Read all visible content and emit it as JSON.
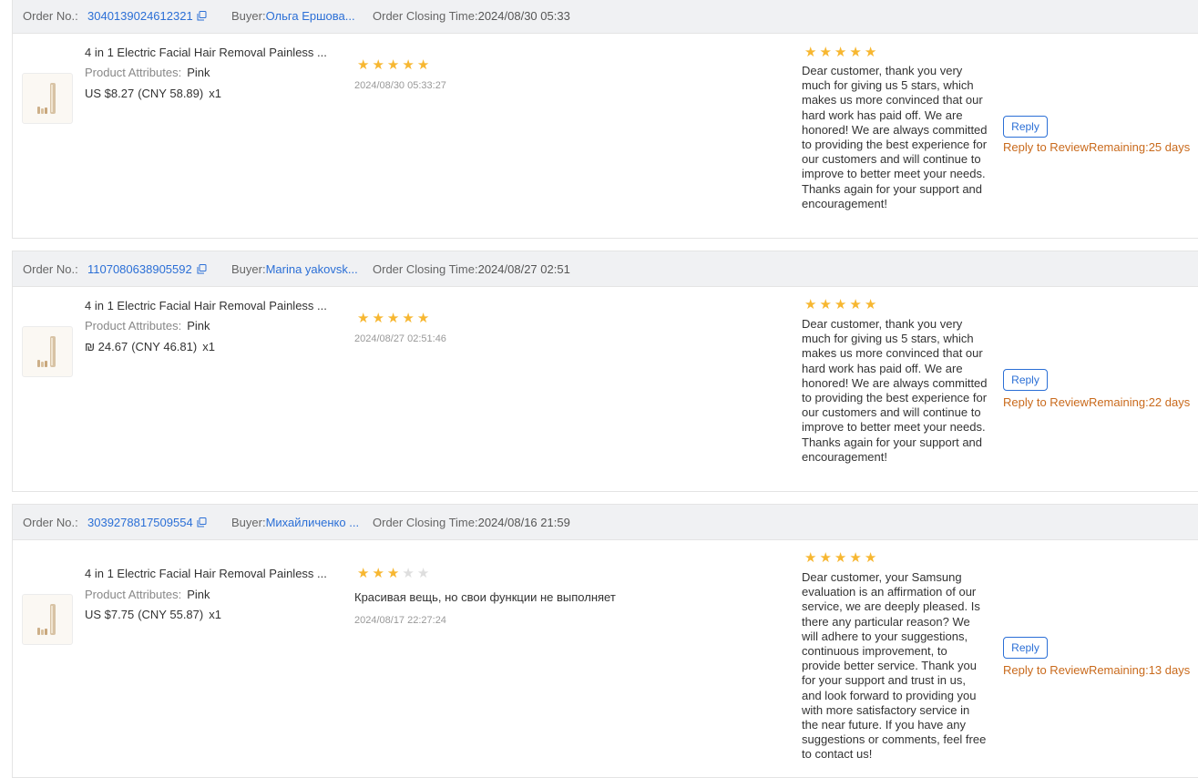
{
  "labels": {
    "order_no": "Order No.:",
    "buyer": "Buyer:",
    "closing": "Order Closing Time:",
    "product_attributes": "Product Attributes:",
    "reply_button": "Reply",
    "reply_to_review": "Reply to Review"
  },
  "colors": {
    "link": "#2b6fd6",
    "star_filled": "#f7b731",
    "star_empty": "#dedede",
    "remaining": "#c96a1c",
    "header_bg": "#f0f1f3"
  },
  "orders": [
    {
      "order_no": "3040139024612321",
      "buyer": "Ольга Ершова...",
      "closing_time": "2024/08/30 05:33",
      "product": {
        "title": "4 in 1 Electric Facial Hair Removal Painless ...",
        "attribute": "Pink",
        "price": "US $8.27",
        "cny": "(CNY  58.89)",
        "qty": "x1"
      },
      "rating": 5,
      "review_text": "",
      "review_date": "2024/08/30 05:33:27",
      "reply_rating": 5,
      "reply_text": "Dear customer, thank you very much for giving us 5 stars, which makes us more convinced that our hard work has paid off. We are honored! We are always committed to providing the best experience for our customers and will continue to improve to better meet your needs. Thanks again for your support and encouragement!",
      "remaining": "Remaining:25 days"
    },
    {
      "order_no": "1107080638905592",
      "buyer": "Marina yakovsk...",
      "closing_time": "2024/08/27 02:51",
      "product": {
        "title": "4 in 1 Electric Facial Hair Removal Painless ...",
        "attribute": "Pink",
        "price": "₪ 24.67",
        "cny": "(CNY  46.81)",
        "qty": "x1"
      },
      "rating": 5,
      "review_text": "",
      "review_date": "2024/08/27 02:51:46",
      "reply_rating": 5,
      "reply_text": "Dear customer, thank you very much for giving us 5 stars, which makes us more convinced that our hard work has paid off. We are honored! We are always committed to providing the best experience for our customers and will continue to improve to better meet your needs. Thanks again for your support and encouragement!",
      "remaining": "Remaining:22 days"
    },
    {
      "order_no": "3039278817509554",
      "buyer": "Михайличенко ...",
      "closing_time": "2024/08/16 21:59",
      "product": {
        "title": "4 in 1 Electric Facial Hair Removal Painless ...",
        "attribute": "Pink",
        "price": "US $7.75",
        "cny": "(CNY  55.87)",
        "qty": "x1"
      },
      "rating": 3,
      "review_text": "Красивая вещь, но свои функции не выполняет",
      "review_date": "2024/08/17 22:27:24",
      "reply_rating": 5,
      "reply_text": "Dear customer, your Samsung evaluation is an affirmation of our service, we are deeply pleased. Is there any particular reason? We will adhere to your suggestions, continuous improvement, to provide better service. Thank you for your support and trust in us, and look forward to providing you with more satisfactory service in the near future. If you have any suggestions or comments, feel free to contact us!",
      "remaining": "Remaining:13 days"
    }
  ]
}
